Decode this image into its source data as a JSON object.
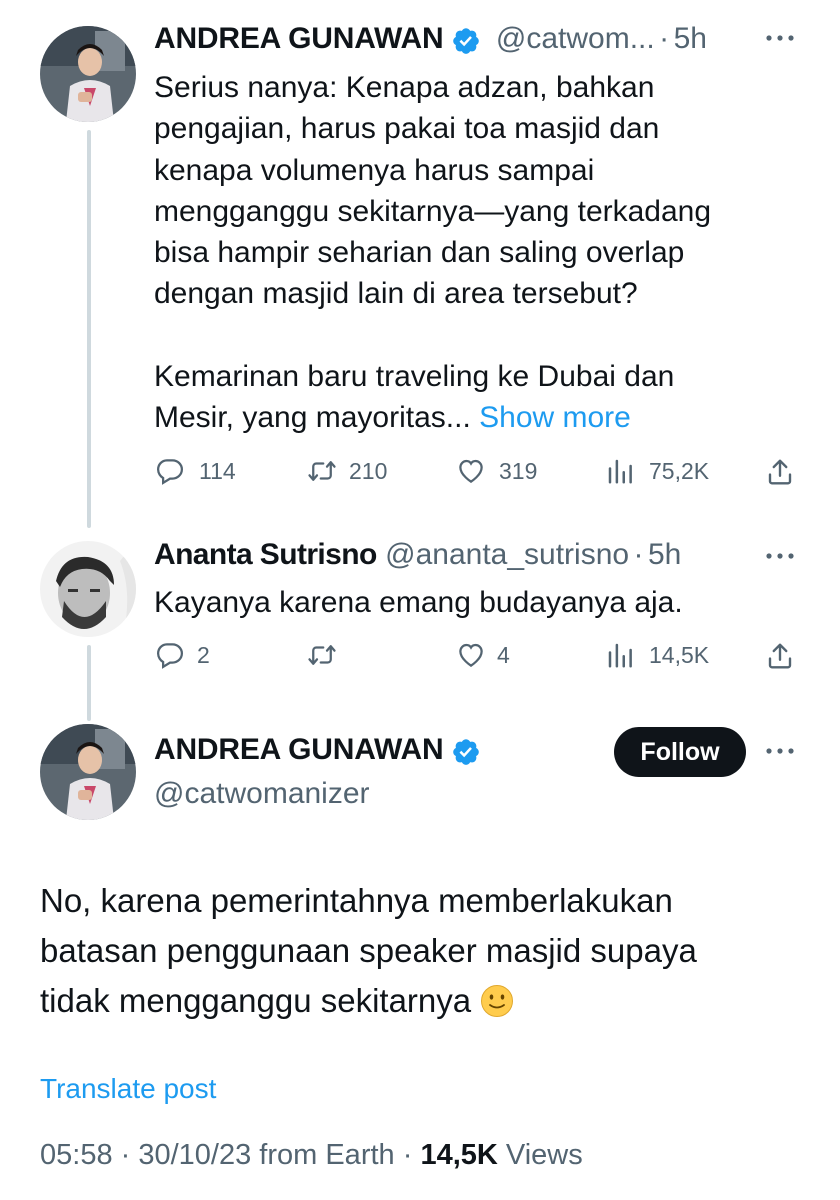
{
  "tweet1": {
    "name": "ANDREA GUNAWAN",
    "handle": "@catwom...",
    "sep": "·",
    "time": "5h",
    "text": "Serius nanya: Kenapa adzan, bahkan\npengajian, harus pakai toa masjid dan\nkenapa volumenya harus sampai\nmengganggu sekitarnya—yang terkadang\nbisa hampir seharian dan saling overlap\ndengan masjid lain di area tersebut?\n\nKemarinan baru traveling ke Dubai dan\nMesir, yang mayoritas...",
    "show_more": "Show more",
    "replies": "114",
    "reposts": "210",
    "likes": "319",
    "views": "75,2K"
  },
  "tweet2": {
    "name": "Ananta Sutrisno",
    "handle": "@ananta_sutrisno",
    "sep": "·",
    "time": "5h",
    "text": "Kayanya karena emang budayanya aja.",
    "replies": "2",
    "likes": "4",
    "views": "14,5K"
  },
  "main": {
    "name": "ANDREA GUNAWAN",
    "handle": "@catwomanizer",
    "follow_label": "Follow",
    "text": "No, karena pemerintahnya memberlakukan\nbatasan penggunaan speaker masjid supaya\ntidak mengganggu sekitarnya",
    "translate": "Translate post",
    "meta_time": "05:58 · 30/10/23 from Earth ·",
    "meta_views_count": "14,5K",
    "meta_views_label": "Views"
  },
  "colors": {
    "text": "#0f1419",
    "secondary": "#536471",
    "link": "#1d9bf0",
    "verified": "#1d9bf0",
    "follow_bg": "#0f1419"
  },
  "icons": [
    "reply-icon",
    "repost-icon",
    "like-icon",
    "views-icon",
    "share-icon",
    "more-icon",
    "verified-badge-icon",
    "smile-emoji-icon"
  ]
}
